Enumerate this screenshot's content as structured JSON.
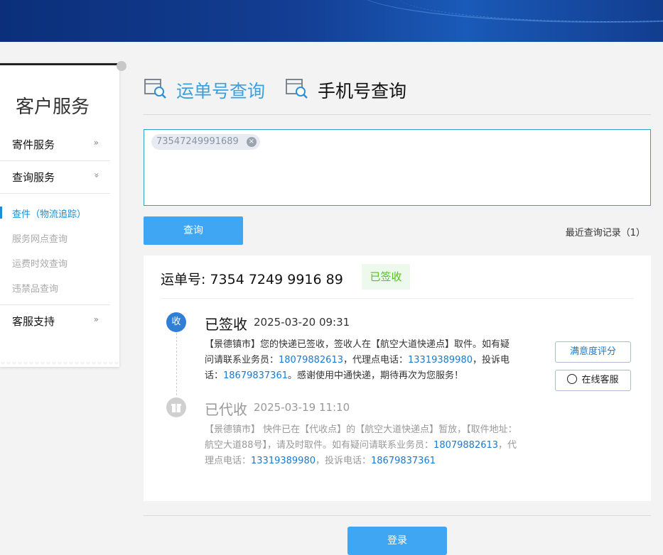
{
  "sidebar": {
    "title": "客户服务",
    "items": [
      {
        "label": "寄件服务",
        "chevron": "»"
      },
      {
        "label": "查询服务",
        "chevron": "«"
      },
      {
        "label": "客服支持",
        "chevron": "»"
      }
    ],
    "sub_items": [
      {
        "label": "查件（物流追踪）",
        "active": true
      },
      {
        "label": "服务网点查询",
        "active": false
      },
      {
        "label": "运费时效查询",
        "active": false
      },
      {
        "label": "违禁品查询",
        "active": false
      }
    ]
  },
  "tabs": [
    {
      "label": "运单号查询",
      "active": true,
      "color": "#3aa0e0"
    },
    {
      "label": "手机号查询",
      "active": false,
      "color": "#111111"
    }
  ],
  "search": {
    "chip_value": "73547249991689",
    "remove_glyph": "×"
  },
  "actions": {
    "query_label": "查询",
    "recent_label": "最近查询记录（1）",
    "login_label": "登录"
  },
  "result": {
    "waybill_label": "运单号: 7354 7249 9916 89",
    "status_badge": "已签收",
    "status_color": "#52c41a",
    "rate_button": "满意度评分",
    "cs_button": "在线客服",
    "events": [
      {
        "icon_text": "收",
        "status": "已签收",
        "time": "2025-03-20 09:31",
        "desc_parts": [
          "【景德镇市】您的快递已签收，签收人在【航空大道快递点】取件。如有疑问请联系业务员：",
          "18079882613",
          "，代理点电话：",
          "13319389980",
          "，投诉电话：",
          "18679837361",
          "。感谢使用中通快递，期待再次为您服务！"
        ]
      },
      {
        "icon_text": "",
        "status": "已代收",
        "time": "2025-03-19 11:10",
        "desc_parts": [
          "【景德镇市】 快件已在【代收点】的【航空大道快递点】暂放，【取件地址：航空大道88号】，请及时取件。如有疑问请联系业务员：",
          "18079882613",
          "，代理点电话：",
          "13319389980",
          "，投诉电话：",
          "18679837361",
          ""
        ]
      }
    ]
  }
}
